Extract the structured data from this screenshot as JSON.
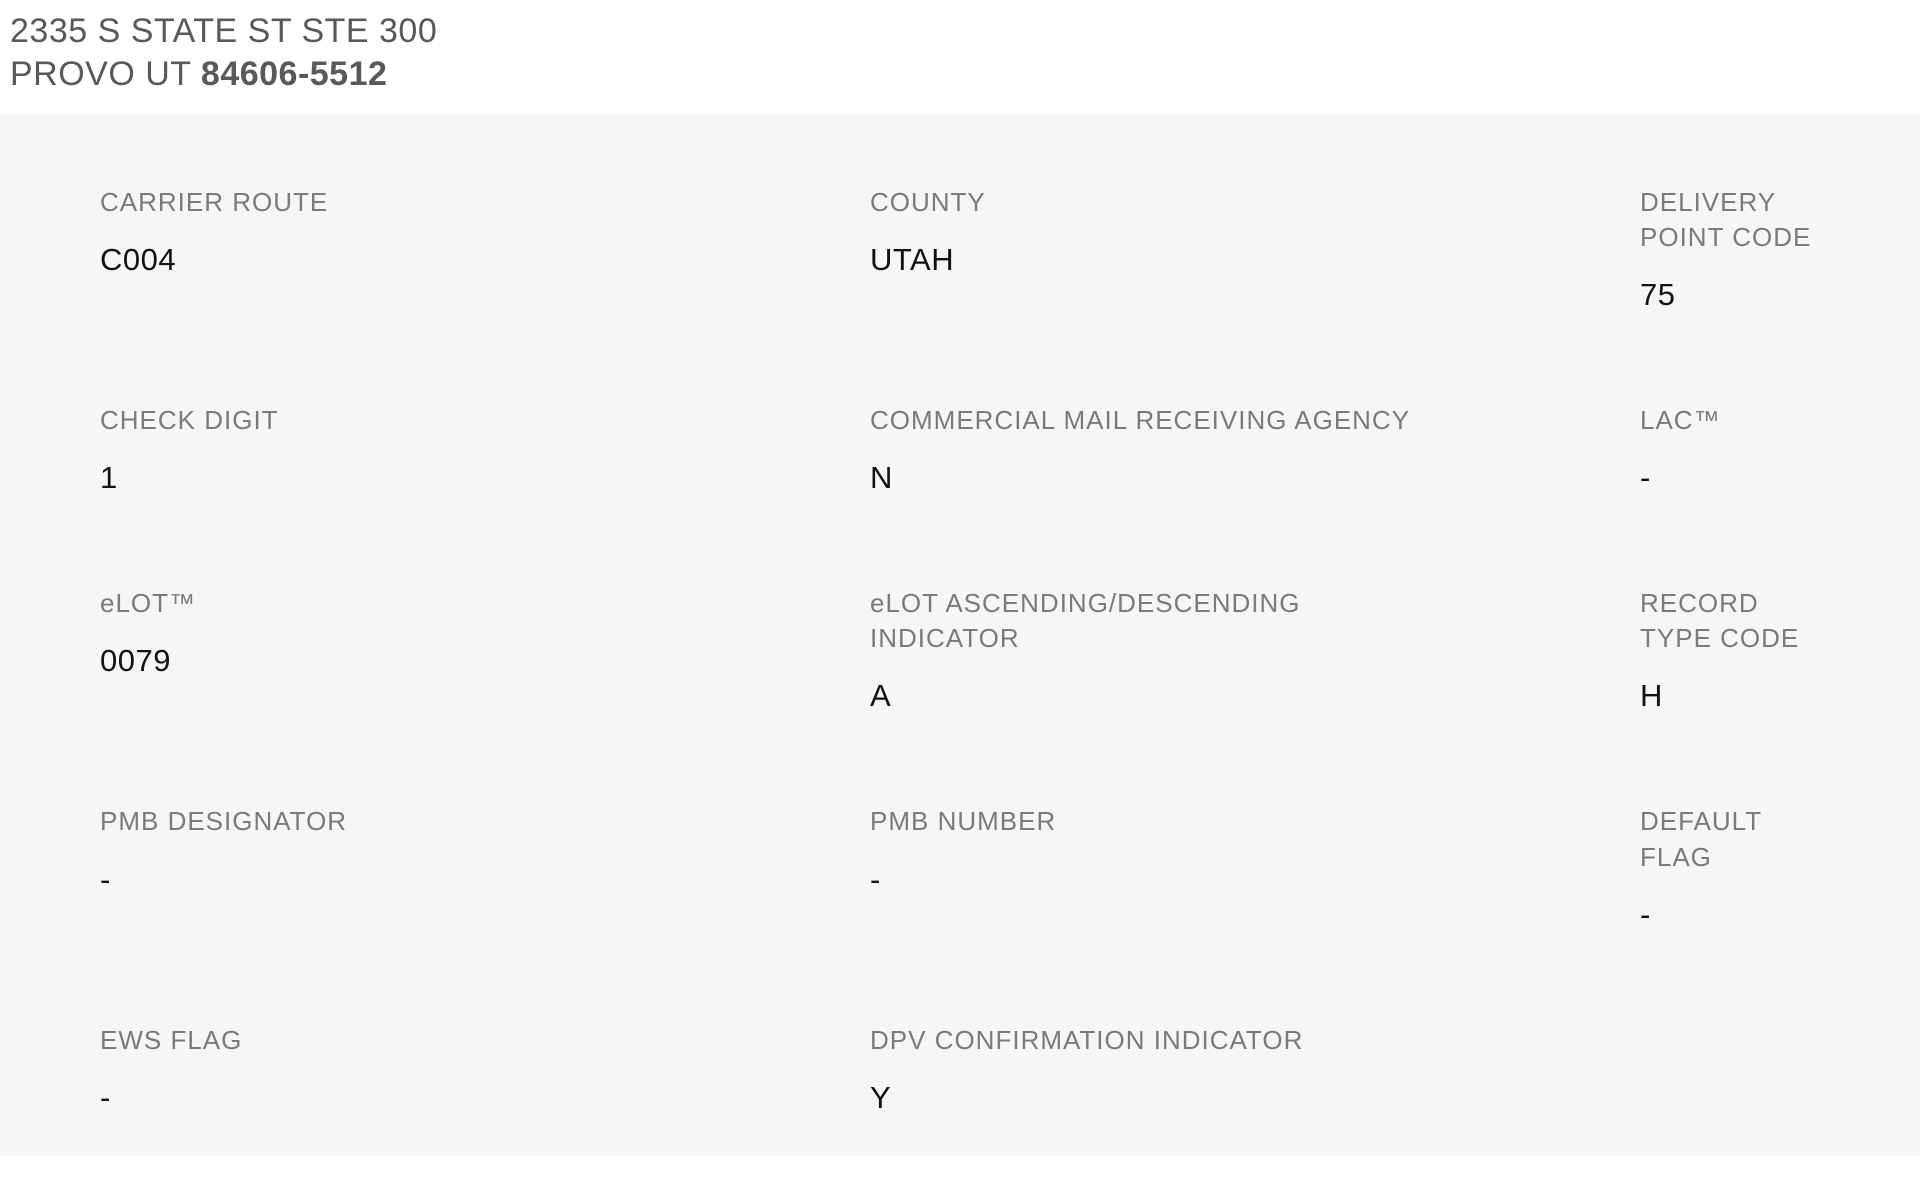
{
  "address": {
    "line1": "2335 S STATE ST STE 300",
    "city_state": "PROVO UT ",
    "zip": "84606-5512"
  },
  "fields": {
    "carrier_route": {
      "label": "CARRIER ROUTE",
      "value": "C004"
    },
    "county": {
      "label": "COUNTY",
      "value": "UTAH"
    },
    "delivery_point": {
      "label": "DELIVERY POINT CODE",
      "value": "75"
    },
    "check_digit": {
      "label": "CHECK DIGIT",
      "value": "1"
    },
    "cmra": {
      "label": "COMMERCIAL MAIL RECEIVING AGENCY",
      "value": "N"
    },
    "lac": {
      "label": "LAC™",
      "value": "-"
    },
    "elot": {
      "label": "eLOT™",
      "value": "0079"
    },
    "elot_ad": {
      "label": "eLOT ASCENDING/DESCENDING INDICATOR",
      "value": "A"
    },
    "record_type": {
      "label": "RECORD TYPE CODE",
      "value": "H"
    },
    "pmb_designator": {
      "label": "PMB DESIGNATOR",
      "value": "-"
    },
    "pmb_number": {
      "label": "PMB NUMBER",
      "value": "-"
    },
    "default_flag": {
      "label": "DEFAULT FLAG",
      "value": "-"
    },
    "ews_flag": {
      "label": "EWS FLAG",
      "value": "-"
    },
    "dpv_conf": {
      "label": "DPV CONFIRMATION INDICATOR",
      "value": "Y"
    }
  }
}
